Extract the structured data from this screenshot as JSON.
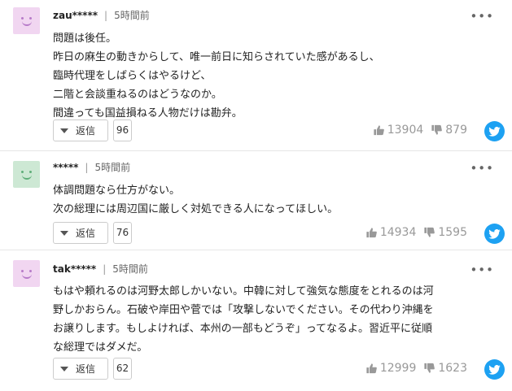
{
  "reply_label": "返信",
  "more_glyph": "•••",
  "comments": [
    {
      "user": "zau*****",
      "time": "5時間前",
      "lines": [
        "問題は後任。",
        "昨日の麻生の動きからして、唯一前日に知らされていた感があるし、",
        "臨時代理をしばらくはやるけど、",
        "二階と会談重ねるのはどうなのか。",
        "間違っても国益損ねる人物だけは勘弁。"
      ],
      "reply_count": "96",
      "likes": "13904",
      "dislikes": "879",
      "avatar_bg": "#f1d6f1",
      "avatar_fg": "#b77bc9"
    },
    {
      "user": "*****",
      "time": "5時間前",
      "lines": [
        "体調問題なら仕方がない。",
        "次の総理には周辺国に厳しく対処できる人になってほしい。"
      ],
      "reply_count": "76",
      "likes": "14934",
      "dislikes": "1595",
      "avatar_bg": "#cde8d4",
      "avatar_fg": "#5fae79"
    },
    {
      "user": "tak*****",
      "time": "5時間前",
      "lines": [
        "もはや頼れるのは河野太郎しかいない。中韓に対して強気な態度をとれるのは河",
        "野しかおらん。石破や岸田や菅では「攻撃しないでください。その代わり沖縄を",
        "お譲りします。もしよければ、本州の一部もどうぞ」ってなるよ。習近平に従順",
        "な総理ではダメだ。"
      ],
      "reply_count": "62",
      "likes": "12999",
      "dislikes": "1623",
      "avatar_bg": "#f1d6f1",
      "avatar_fg": "#b77bc9"
    }
  ]
}
